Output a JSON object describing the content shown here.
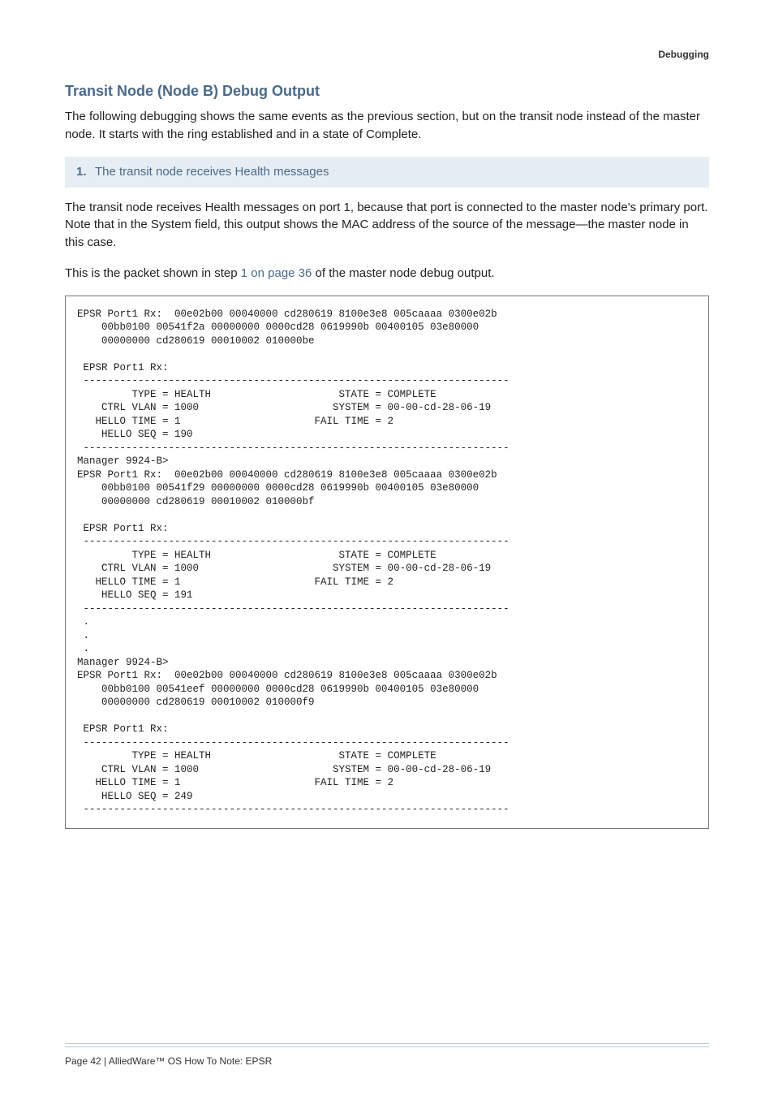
{
  "running_head": "Debugging",
  "heading": "Transit Node (Node B) Debug Output",
  "intro": "The following debugging shows the same events as the previous section, but on the transit node instead of the master node. It starts with the ring established and in a state of Complete.",
  "step": {
    "number": "1.",
    "title": "The transit node receives Health messages"
  },
  "para2_part1": "The transit node receives Health messages on port 1, because that port is connected to the master node's primary port. Note that in the System field, this output shows the MAC address of the source of the message—the master node in this case.",
  "para3_prefix": "This is the packet shown in step ",
  "para3_link": "1 on page 36",
  "para3_suffix": " of the master node debug output.",
  "code": "EPSR Port1 Rx:  00e02b00 00040000 cd280619 8100e3e8 005caaaa 0300e02b\n    00bb0100 00541f2a 00000000 0000cd28 0619990b 00400105 03e80000\n    00000000 cd280619 00010002 010000be\n\n EPSR Port1 Rx:\n ----------------------------------------------------------------------\n         TYPE = HEALTH                     STATE = COMPLETE\n    CTRL VLAN = 1000                      SYSTEM = 00-00-cd-28-06-19\n   HELLO TIME = 1                      FAIL TIME = 2\n    HELLO SEQ = 190\n ----------------------------------------------------------------------\nManager 9924-B>\nEPSR Port1 Rx:  00e02b00 00040000 cd280619 8100e3e8 005caaaa 0300e02b\n    00bb0100 00541f29 00000000 0000cd28 0619990b 00400105 03e80000\n    00000000 cd280619 00010002 010000bf\n\n EPSR Port1 Rx:\n ----------------------------------------------------------------------\n         TYPE = HEALTH                     STATE = COMPLETE\n    CTRL VLAN = 1000                      SYSTEM = 00-00-cd-28-06-19\n   HELLO TIME = 1                      FAIL TIME = 2\n    HELLO SEQ = 191\n ----------------------------------------------------------------------\n .\n .\n .\nManager 9924-B>\nEPSR Port1 Rx:  00e02b00 00040000 cd280619 8100e3e8 005caaaa 0300e02b\n    00bb0100 00541eef 00000000 0000cd28 0619990b 00400105 03e80000\n    00000000 cd280619 00010002 010000f9\n\n EPSR Port1 Rx:\n ----------------------------------------------------------------------\n         TYPE = HEALTH                     STATE = COMPLETE\n    CTRL VLAN = 1000                      SYSTEM = 00-00-cd-28-06-19\n   HELLO TIME = 1                      FAIL TIME = 2\n    HELLO SEQ = 249\n ----------------------------------------------------------------------",
  "footer": "Page 42 | AlliedWare™ OS How To Note: EPSR"
}
